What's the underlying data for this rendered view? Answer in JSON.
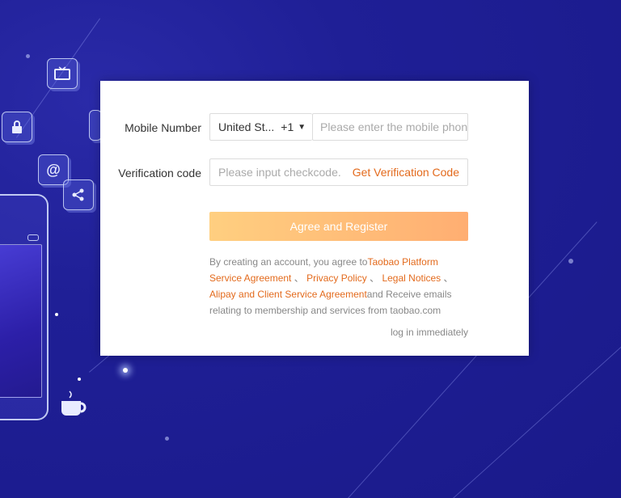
{
  "form": {
    "mobile_label": "Mobile Number",
    "country_name": "United St...",
    "country_code": "+1",
    "mobile_placeholder": "Please enter the mobile phone",
    "verification_label": "Verification code",
    "code_placeholder": "Please input checkcode.",
    "get_code_label": "Get Verification Code",
    "register_label": "Agree and Register",
    "terms": {
      "intro": "By creating an account, you agree to",
      "link_service": "Taobao Platform Service Agreement",
      "sep1": " 、",
      "link_privacy": "Privacy Policy",
      "sep2": " 、",
      "link_legal": "Legal Notices",
      "sep3": " 、",
      "link_alipay": "Alipay and Client Service Agreement",
      "outro": "and Receive emails relating to membership and services from taobao.com"
    },
    "login_link": "log in immediately"
  },
  "colors": {
    "accent": "#e36a1c",
    "background": "#1f1f96",
    "button_start": "#ffcf80",
    "button_end": "#ffae72"
  },
  "icons": [
    "tv-icon",
    "lock-icon",
    "at-icon",
    "share-icon",
    "globe-icon",
    "cup-icon",
    "phone-illustration"
  ]
}
